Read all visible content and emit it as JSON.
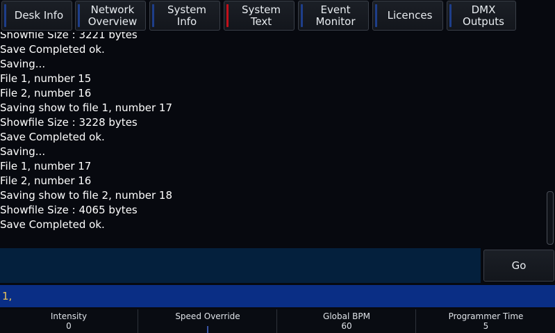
{
  "tabs": [
    {
      "label": "Desk Info",
      "active": false
    },
    {
      "label": "Network\nOverview",
      "active": false
    },
    {
      "label": "System\nInfo",
      "active": false
    },
    {
      "label": "System\nText",
      "active": true
    },
    {
      "label": "Event\nMonitor",
      "active": false
    },
    {
      "label": "Licences",
      "active": false
    },
    {
      "label": "DMX\nOutputs",
      "active": false
    }
  ],
  "log": [
    "Showfile Size : 3221 bytes",
    "Save Completed ok.",
    "Saving...",
    "File 1, number 15",
    "File 2, number 16",
    "Saving show to file 1, number 17",
    "Showfile Size : 3228 bytes",
    "Save Completed ok.",
    "Saving...",
    "File 1, number 17",
    "File 2, number 16",
    "Saving show to file 2, number 18",
    "Showfile Size : 4065 bytes",
    "Save Completed ok."
  ],
  "command": {
    "input_value": "",
    "go_label": "Go",
    "command_line": "1,"
  },
  "status": {
    "intensity_label": "Intensity",
    "intensity_value": "0",
    "speed_label": "Speed Override",
    "speed_value": "",
    "bpm_label": "Global BPM",
    "bpm_value": "60",
    "programmer_label": "Programmer Time",
    "programmer_value": "5"
  },
  "colors": {
    "active_tab_stripe": "#c2101a",
    "tab_stripe": "#1e3e8a",
    "command_line_bg": "#0a2e85",
    "command_text": "#e9c35b",
    "input_bg": "#04203d"
  }
}
